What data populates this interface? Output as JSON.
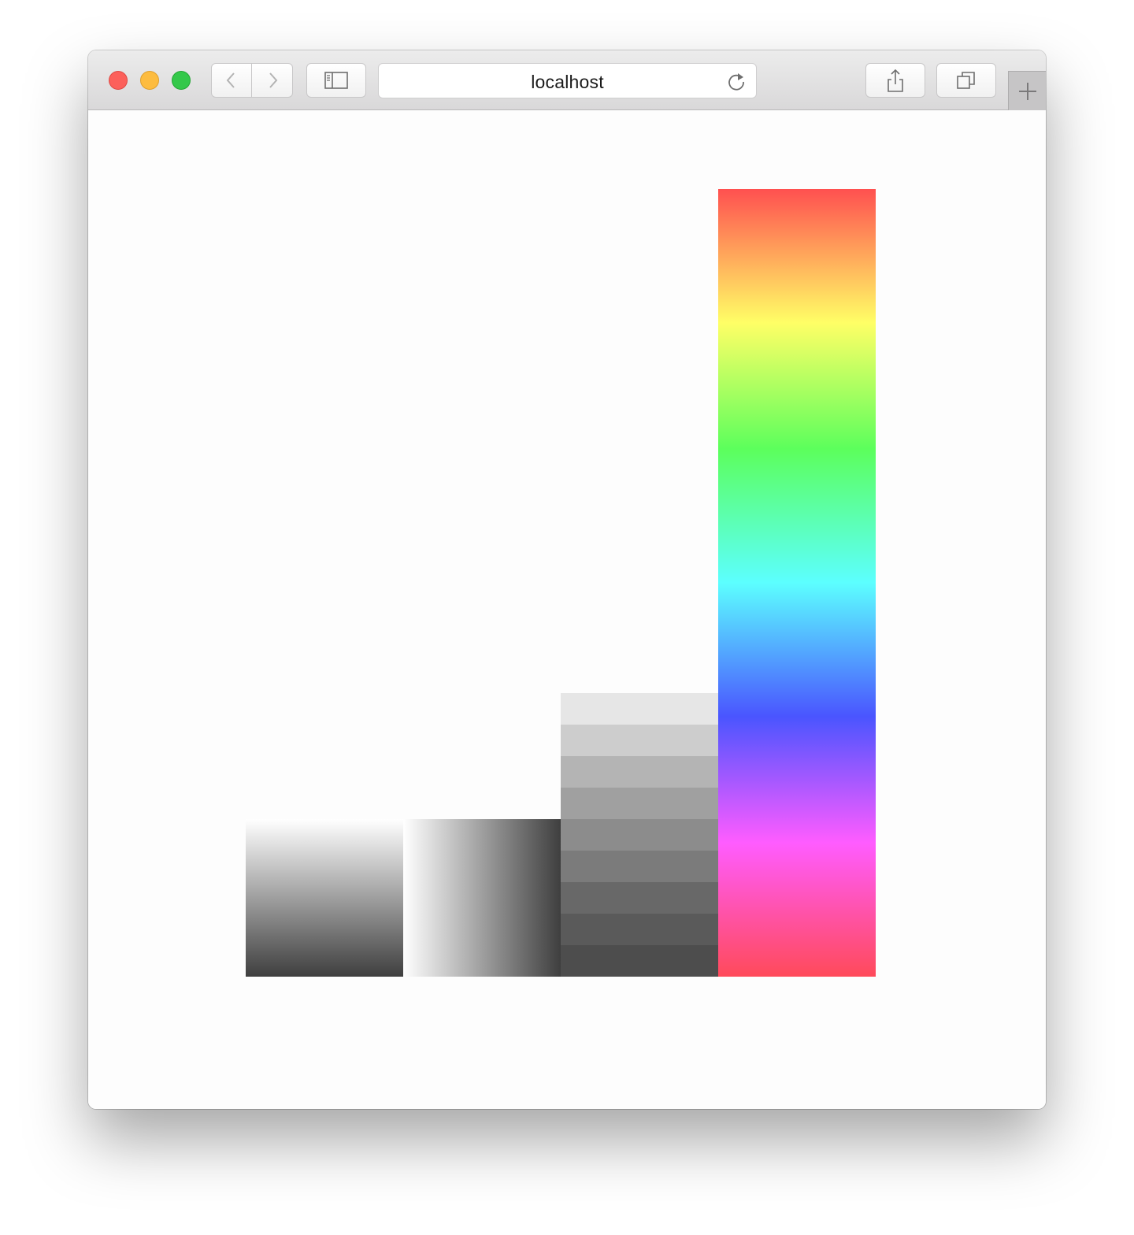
{
  "browser": {
    "url": "localhost",
    "icons": {
      "back": "chevron-left-icon",
      "forward": "chevron-right-icon",
      "sidebar": "sidebar-icon",
      "reload": "reload-icon",
      "share": "share-icon",
      "tabs": "tabs-overview-icon",
      "new_tab": "plus-icon"
    },
    "traffic_lights": {
      "close": "#fc605b",
      "minimize": "#fdbc40",
      "maximize": "#34c84a"
    }
  },
  "bars": [
    {
      "name": "vertical-grey-gradient",
      "relative_height": 0.2,
      "colors": [
        "#ffffff",
        "#3f3f3f"
      ],
      "direction": "top-to-bottom"
    },
    {
      "name": "horizontal-grey-gradient",
      "relative_height": 0.2,
      "colors": [
        "#ffffff",
        "#3f3f3f"
      ],
      "direction": "left-to-right"
    },
    {
      "name": "stepped-grey-bands",
      "relative_height": 0.36,
      "bands": [
        "#e6e6e6",
        "#cdcdcd",
        "#b4b4b4",
        "#a0a0a0",
        "#8c8c8c",
        "#7b7b7b",
        "#686868",
        "#5a5a5a",
        "#4d4d4d"
      ]
    },
    {
      "name": "rainbow-gradient",
      "relative_height": 1.0,
      "colors": [
        "#ff5050",
        "#ffff66",
        "#5cff5c",
        "#5cffff",
        "#4a55ff",
        "#ff5cff",
        "#ff4a5a"
      ],
      "direction": "top-to-bottom"
    }
  ]
}
